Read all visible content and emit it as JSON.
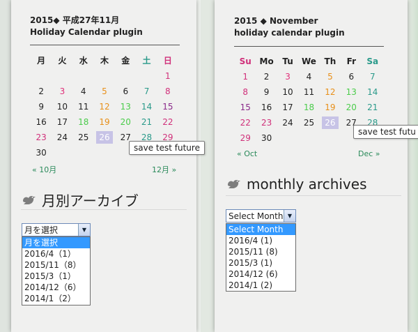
{
  "jp": {
    "title_line1": "2015◆ 平成27年11月",
    "title_line2": "Holiday Calendar plugin",
    "weekdays": [
      "月",
      "火",
      "水",
      "木",
      "金",
      "土",
      "日"
    ],
    "weeks": [
      [
        "",
        "",
        "",
        "",
        "",
        "",
        "1"
      ],
      [
        "2",
        "3",
        "4",
        "5",
        "6",
        "7",
        "8"
      ],
      [
        "9",
        "10",
        "11",
        "12",
        "13",
        "14",
        "15"
      ],
      [
        "16",
        "17",
        "18",
        "19",
        "20",
        "21",
        "22"
      ],
      [
        "23",
        "24",
        "25",
        "26",
        "27",
        "28",
        "29"
      ],
      [
        "30",
        "",
        "",
        "",
        "",
        "",
        ""
      ]
    ],
    "prev": "« 10月",
    "next": "12月 »",
    "tooltip": "save test future",
    "archive_title": "月別アーカイブ",
    "select_value": "月を選択",
    "options": [
      "月を選択",
      "2016/4（1）",
      "2015/11（8）",
      "2015/3（1）",
      "2014/12（6）",
      "2014/1（2）"
    ]
  },
  "en": {
    "title_line1": "2015 ◆ November",
    "title_line2": "holiday calendar plugin",
    "weekdays": [
      "Su",
      "Mo",
      "Tu",
      "We",
      "Th",
      "Fr",
      "Sa"
    ],
    "weeks": [
      [
        "1",
        "2",
        "3",
        "4",
        "5",
        "6",
        "7"
      ],
      [
        "8",
        "9",
        "10",
        "11",
        "12",
        "13",
        "14"
      ],
      [
        "15",
        "16",
        "17",
        "18",
        "19",
        "20",
        "21"
      ],
      [
        "22",
        "23",
        "24",
        "25",
        "26",
        "27",
        "28"
      ],
      [
        "29",
        "30",
        "",
        "",
        "",
        "",
        ""
      ]
    ],
    "prev": "« Oct",
    "next": "Dec »",
    "tooltip": "save test futu",
    "archive_title": "monthly archives",
    "select_value": "Select Month",
    "options": [
      "Select Month",
      "2016/4  (1)",
      "2015/11  (8)",
      "2015/3  (1)",
      "2014/12  (6)",
      "2014/1  (2)"
    ]
  },
  "colors": {
    "sunday": "#d0307a",
    "saturday": "#2a9a8a",
    "holiday": "#8a2a8a",
    "today_bg": "#c7c3e6",
    "nav_link": "#2a8a5a",
    "dropdown_selected": "#3399ff"
  }
}
